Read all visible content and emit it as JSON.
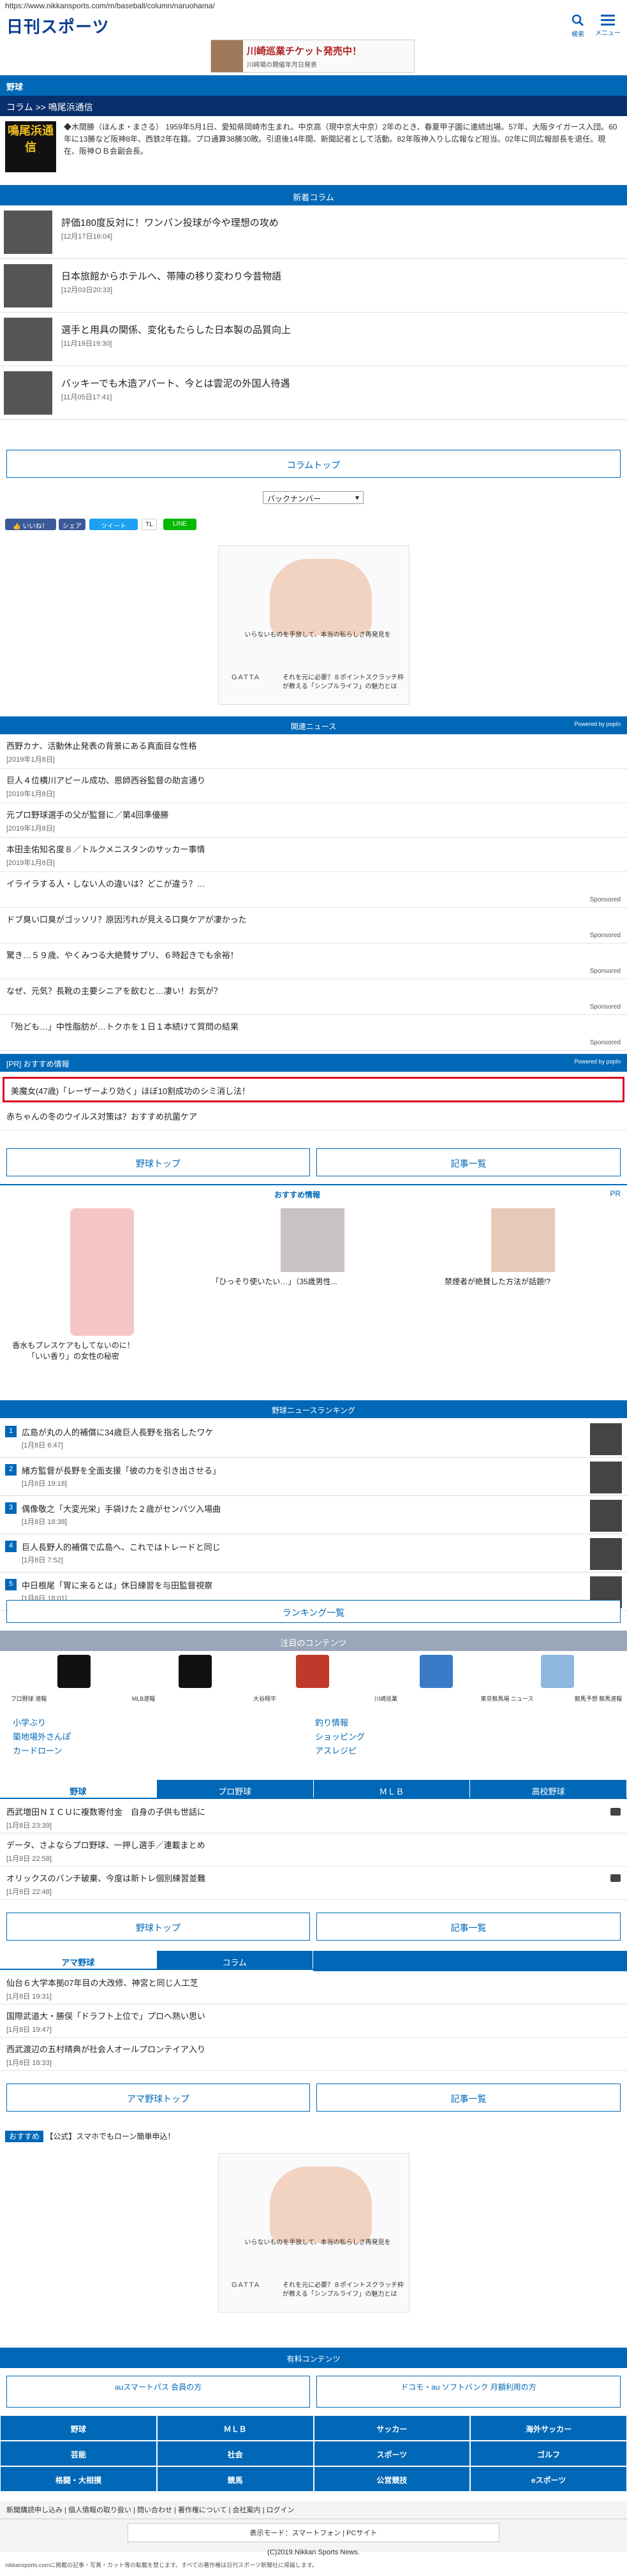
{
  "browser": {
    "url": "https://www.nikkansports.com/m/baseball/column/naruohama/"
  },
  "header": {
    "logo": "日刊スポーツ",
    "search_label": "検索",
    "menu_label": "メニュー"
  },
  "top_ad": {
    "title": "川崎巡業チケット発売中！",
    "sub": "川崎場の開催年月日発表"
  },
  "category": "野球",
  "column_bar": "コラム >> 鳴尾浜通信",
  "profile": {
    "logo_text": "鳴尾浜通信",
    "text": "◆木間勝（ほんま・まさる） 1959年5月1日、愛知県岡崎市生まれ。中京高（現中京大中京）2年のとき、春夏甲子園に連続出場。57年、大阪タイガース入団。60年に13勝など阪神8年、西鉄2年在籍。プロ通算38勝30敗。引退後14年間、新聞記者として活動。82年阪神入りし広報など担当。02年に同広報部長を退任。現在、阪神ＯＢ会副会長。"
  },
  "new_column": {
    "heading": "新着コラム",
    "items": [
      {
        "title": "評価180度反対に！ワンパン投球が今や理想の攻め",
        "date": "[12月17日16:04]"
      },
      {
        "title": "日本旅館からホテルへ、帯陣の移り変わり今昔物語",
        "date": "[12月03日20:33]"
      },
      {
        "title": "選手と用具の関係、変化もたらした日本製の品質向上",
        "date": "[11月19日19:30]"
      },
      {
        "title": "バッキーでも木造アパート、今とは雲泥の外国人待遇",
        "date": "[11月05日17:41]"
      }
    ]
  },
  "column_top_button": "コラムトップ",
  "backnumber": "バックナンバー",
  "share": {
    "like": "いいね！",
    "share": "シェア",
    "tweet": "ツイート",
    "tl": "TL",
    "line": "LINE"
  },
  "ad1": {
    "caption": "いらないものを手放して、本当の私らしさ再発見を",
    "brand": "GATTA",
    "copy": "それを元に必要？８ポイントスクラッチ枠が教える「シンプルライフ」の魅力とは"
  },
  "recommend_news": {
    "heading": "関連ニュース",
    "powered": "Powered by popIn",
    "items": [
      {
        "title": "西野カナ、活動休止発表の背景にある真面目な性格",
        "date": "[2019年1月8日]"
      },
      {
        "title": "巨人４位横川アピール成功、恩師西谷監督の助言通り",
        "date": "[2019年1月8日]"
      },
      {
        "title": "元プロ野球選手の父が監督に／第4回準優勝",
        "date": "[2019年1月8日]"
      },
      {
        "title": "本田圭佑知名度８／トルクメニスタンのサッカー事情",
        "date": "[2019年1月8日]"
      }
    ],
    "sponsored": [
      "イライラする人・しない人の違いは？どこが違う？…",
      "ドブ臭い口臭がゴッソリ？原因汚れが見える口臭ケアが凄かった",
      "驚き…５９歳、やくみつる大絶賛サプリ、６時起きでも余裕！",
      "なぜ、元気？長靴の主要シニアを飲むと…凄い！お気が？",
      "「殆ども…」中性脂肪が…トクホを１日１本続けて質問の結果"
    ],
    "sponsored_label": "Sponsored"
  },
  "pr": {
    "heading": "[PR] おすすめ情報",
    "powered": "Powered by popIn",
    "highlight": "美魔女(47歳)「レーザーより効く」ほぼ10割成功のシミ消し法！",
    "item2": "赤ちゃんの冬のウイルス対策は？おすすめ抗菌ケア"
  },
  "nav_buttons": {
    "baseball_top": "野球トップ",
    "article_list": "記事一覧"
  },
  "osusume": {
    "heading": "おすすめ情報",
    "pr": "PR",
    "tiles": [
      {
        "title": "香水もプレスケアもしてないのに！「いい香り」の女性の秘密"
      },
      {
        "title": "「ひっそり使いたい…」（35歳男性..."
      },
      {
        "title": "禁煙者が絶賛した方法が話題!?"
      }
    ]
  },
  "ranking": {
    "heading": "野球ニュースランキング",
    "items": [
      {
        "no": "1",
        "title": "広島が丸の人的補償に34歳巨人長野を指名したワケ",
        "date": "[1月8日 6:47]"
      },
      {
        "no": "2",
        "title": "緒方監督が長野を全面支援「彼の力を引き出させる」",
        "date": "[1月8日 19:18]"
      },
      {
        "no": "3",
        "title": "偶像敬之「大変光栄」手袋けた２歳がセンバツ入場曲",
        "date": "[1月8日 18:38]"
      },
      {
        "no": "4",
        "title": "巨人長野人的補償で広島へ、これではトレードと同じ",
        "date": "[1月8日 7:52]"
      },
      {
        "no": "5",
        "title": "中日根尾「胃に来るとは」休日練習を与田監督視察",
        "date": "[1月8日 18:01]"
      }
    ],
    "button": "ランキング一覧"
  },
  "recommend_contents": {
    "heading": "注目のコンテンツ",
    "icons": [
      {
        "label": "プロ野球 速報"
      },
      {
        "label": "MLB速報"
      },
      {
        "label": "大谷翔平"
      },
      {
        "label": "川崎巡業"
      },
      {
        "label": "東京競馬場 ニュース"
      },
      {
        "label": "競馬予想 競馬速報"
      }
    ],
    "links_left": [
      "小学ぶり",
      "築地場外さんぽ",
      "カードローン"
    ],
    "links_right": [
      "釣り情報",
      "ショッピング",
      "アスレジピ"
    ]
  },
  "tabs1": {
    "tabs": [
      "野球",
      "プロ野球",
      "ＭＬＢ",
      "高校野球"
    ],
    "items": [
      {
        "title": "西武増田ＮＩＣＵに複数寄付金　自身の子供も世話に",
        "date": "[1月8日 23:39]"
      },
      {
        "title": "データ、さよならプロ野球、一押し選手／連載まとめ",
        "date": "[1月8日 22:58]"
      },
      {
        "title": "オリックスのバンチ破棄、今度は新トレ個別練習並難",
        "date": "[1月8日 22:48]"
      }
    ]
  },
  "tabs2": {
    "tabs": [
      "アマ野球",
      "コラム"
    ],
    "items": [
      {
        "title": "仙台６大学本拠07年目の大改修、神宮と同じ人工芝",
        "date": "[1月8日 19:31]"
      },
      {
        "title": "国際武道大・勝俣「ドラフト上位で」プロへ熱い思い",
        "date": "[1月8日 19:47]"
      },
      {
        "title": "西武渡辺の五村晴典が社会人オールプロンテイア入り",
        "date": "[1月8日 18:33]"
      }
    ],
    "amateur_top": "アマ野球トップ",
    "list": "記事一覧"
  },
  "osusume2": {
    "label": "おすすめ",
    "text": "【公式】スマホでもローン簡単申込！"
  },
  "ad2": {
    "caption": "いらないものを手放して、本当の私らしさ再発見を",
    "brand": "GATTA",
    "copy": "それを元に必要？８ポイントスクラッチ枠が教える「シンプルライフ」の魅力とは"
  },
  "paid": {
    "heading": "有料コンテンツ",
    "btn1": "auスマートパス 会員の方",
    "btn2": "ドコモ・au ソフトバンク 月額利用の方",
    "grid": [
      "野球",
      "ＭＬＢ",
      "サッカー",
      "海外サッカー",
      "芸能",
      "社会",
      "スポーツ",
      "ゴルフ",
      "格闘・大相撲",
      "競馬",
      "公営競技",
      "eスポーツ"
    ]
  },
  "footer": {
    "links": "新聞購読申し込み | 個人情報の取り扱い | 問い合わせ | 著作権について | 会社案内 | ログイン",
    "mode": "表示モード：スマートフォン | PCサイト",
    "copyright": "(C)2019.Nikkan Sports News.",
    "notice": "nikkansports.comに掲載の記事・写真・カット等の転載を禁じます。すべての著作権は日刊スポーツ新聞社に帰属します。"
  }
}
